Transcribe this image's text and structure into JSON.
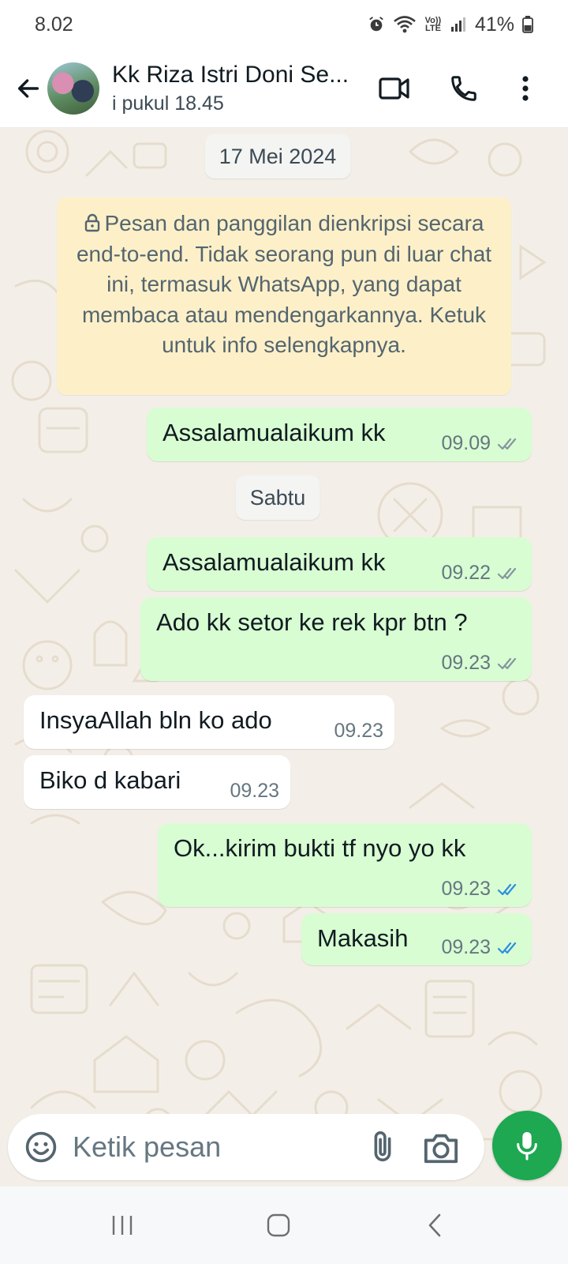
{
  "status_bar": {
    "time": "8.02",
    "battery": "41%",
    "network_label": "Vo)) LTE"
  },
  "header": {
    "contact_name": "Kk Riza Istri Doni Se...",
    "last_seen": "i pukul 18.45"
  },
  "chat": {
    "date_chip_1": "17 Mei 2024",
    "encryption_notice": "Pesan dan panggilan dienkripsi secara end-to-end. Tidak seorang pun di luar chat ini, termasuk WhatsApp, yang dapat membaca atau mendengarkannya. Ketuk untuk info selengkapnya.",
    "date_chip_2": "Sabtu",
    "messages": [
      {
        "direction": "out",
        "text": "Assalamualaikum kk",
        "time": "09.09",
        "status": "delivered"
      },
      {
        "direction": "out",
        "text": "Assalamualaikum kk",
        "time": "09.22",
        "status": "delivered"
      },
      {
        "direction": "out",
        "text": "Ado kk setor ke rek kpr btn ?",
        "time": "09.23",
        "status": "delivered"
      },
      {
        "direction": "in",
        "text": "InsyaAllah bln ko ado",
        "time": "09.23"
      },
      {
        "direction": "in",
        "text": "Biko d kabari",
        "time": "09.23"
      },
      {
        "direction": "out",
        "text": "Ok...kirim bukti tf nyo yo kk",
        "time": "09.23",
        "status": "read"
      },
      {
        "direction": "out",
        "text": "Makasih",
        "time": "09.23",
        "status": "read"
      }
    ]
  },
  "composer": {
    "placeholder": "Ketik pesan"
  },
  "colors": {
    "outgoing_bubble": "#d8fdd2",
    "incoming_bubble": "#ffffff",
    "chat_background": "#f3efe8",
    "encryption_bubble": "#fdf0c9",
    "mic_button": "#1da851",
    "read_tick": "#2c8fe0",
    "delivered_tick": "#8696a0"
  }
}
